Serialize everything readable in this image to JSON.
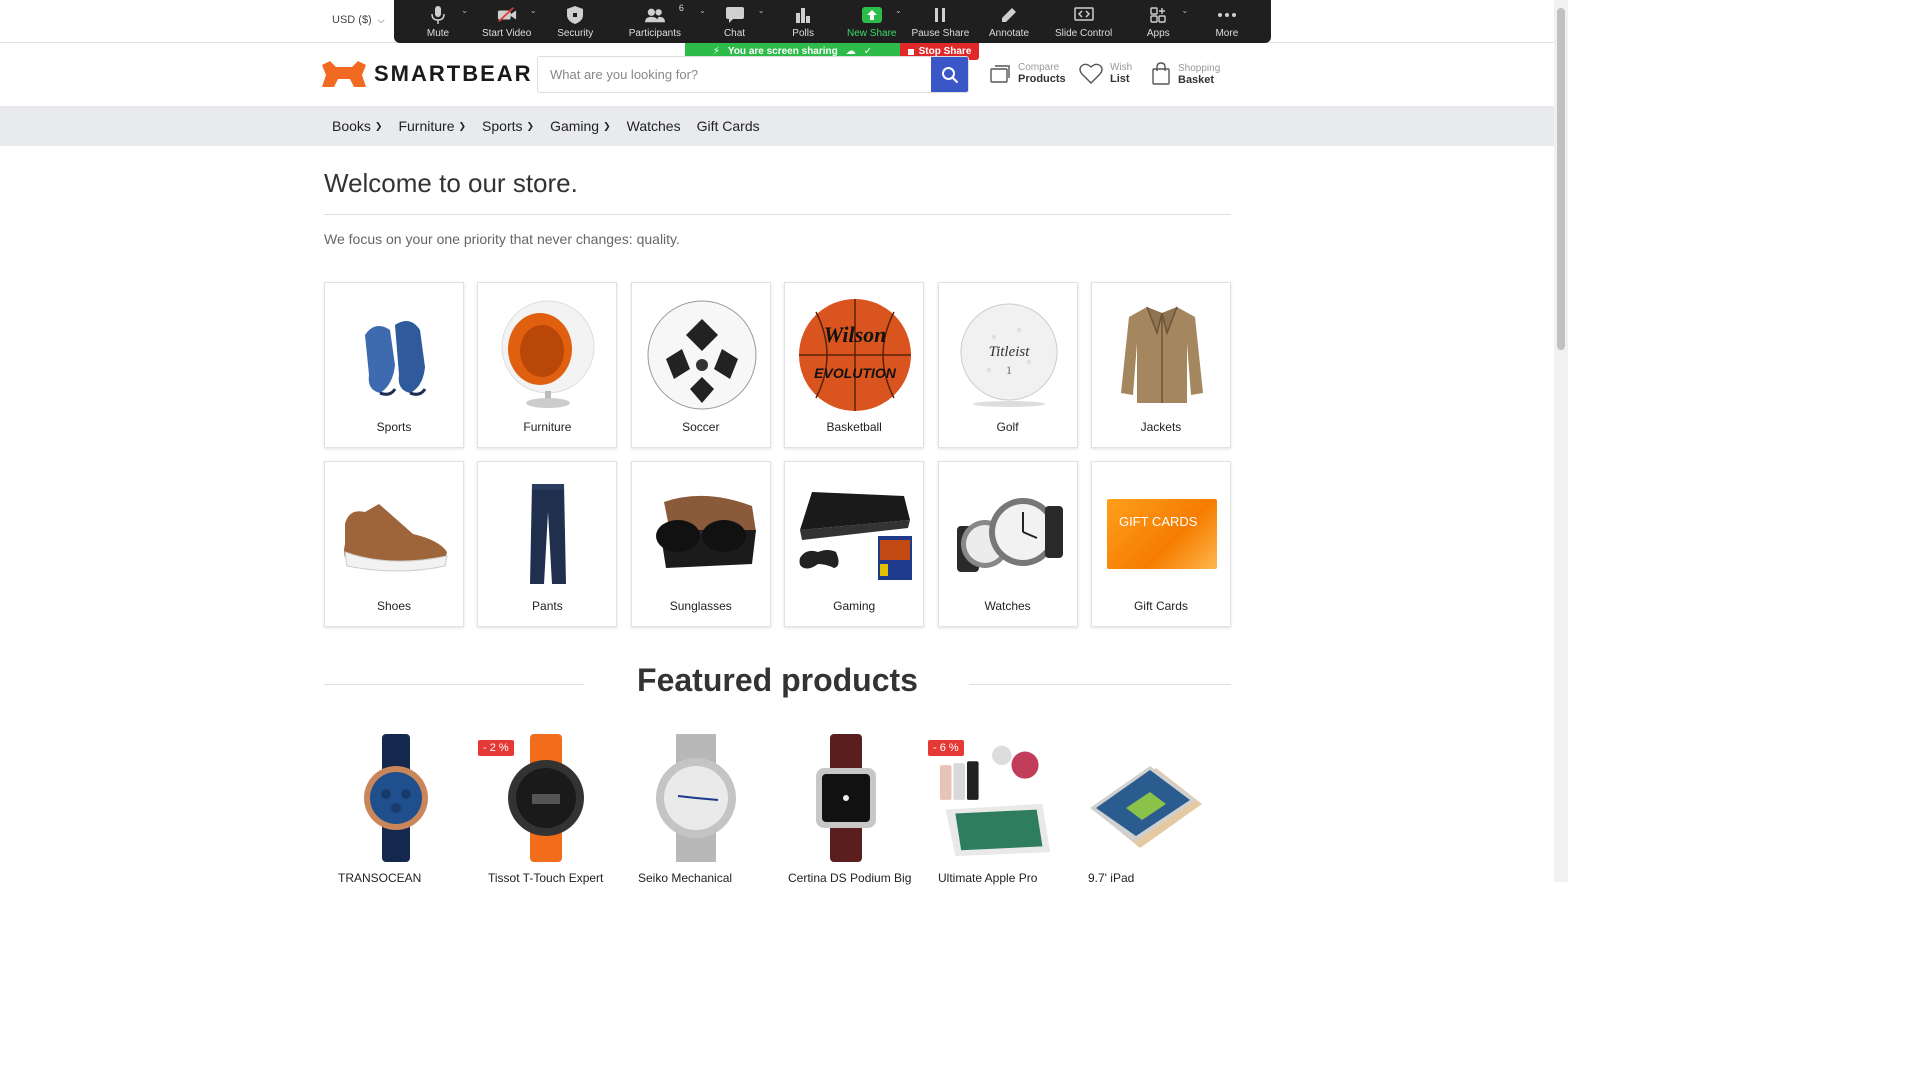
{
  "currency": {
    "label": "USD  ($)"
  },
  "zoom_toolbar": {
    "items": [
      {
        "label": "Mute",
        "icon": "microphone-icon"
      },
      {
        "label": "Start Video",
        "icon": "video-off-icon"
      },
      {
        "label": "Security",
        "icon": "shield-icon"
      },
      {
        "label": "Participants",
        "icon": "participants-icon",
        "count": "6"
      },
      {
        "label": "Chat",
        "icon": "chat-icon"
      },
      {
        "label": "Polls",
        "icon": "polls-icon"
      },
      {
        "label": "New Share",
        "icon": "share-up-icon"
      },
      {
        "label": "Pause Share",
        "icon": "pause-icon"
      },
      {
        "label": "Annotate",
        "icon": "pencil-icon"
      },
      {
        "label": "Slide Control",
        "icon": "slide-control-icon"
      },
      {
        "label": "Apps",
        "icon": "apps-icon"
      },
      {
        "label": "More",
        "icon": "more-dots-icon"
      }
    ],
    "sharing_status": "You are screen sharing",
    "stop_share": "Stop Share",
    "active_color": "#3adb6a"
  },
  "header": {
    "logo_text": "SMARTBEAR",
    "brand_color": "#f26a21",
    "search_placeholder": "What are you looking for?",
    "compare": {
      "small": "Compare",
      "big": "Products"
    },
    "wishlist": {
      "small": "Wish",
      "big": "List"
    },
    "basket": {
      "small": "Shopping",
      "big": "Basket"
    }
  },
  "nav": {
    "items": [
      {
        "label": "Books",
        "dropdown": true
      },
      {
        "label": "Furniture",
        "dropdown": true
      },
      {
        "label": "Sports",
        "dropdown": true
      },
      {
        "label": "Gaming",
        "dropdown": true
      },
      {
        "label": "Watches",
        "dropdown": false
      },
      {
        "label": "Gift Cards",
        "dropdown": false
      }
    ]
  },
  "main": {
    "title": "Welcome to our store.",
    "tagline": "We focus on your one priority that never changes: quality.",
    "categories": [
      {
        "label": "Sports"
      },
      {
        "label": "Furniture"
      },
      {
        "label": "Soccer"
      },
      {
        "label": "Basketball"
      },
      {
        "label": "Golf"
      },
      {
        "label": "Jackets"
      },
      {
        "label": "Shoes"
      },
      {
        "label": "Pants"
      },
      {
        "label": "Sunglasses"
      },
      {
        "label": "Gaming"
      },
      {
        "label": "Watches"
      },
      {
        "label": "Gift Cards"
      }
    ],
    "gift_card_text": "GIFT CARDS",
    "featured_title": "Featured products",
    "products": [
      {
        "name": "TRANSOCEAN",
        "badge": ""
      },
      {
        "name": "Tissot T-Touch Expert",
        "badge": "- 2 %"
      },
      {
        "name": "Seiko Mechanical",
        "badge": ""
      },
      {
        "name": "Certina DS Podium Big",
        "badge": ""
      },
      {
        "name": "Ultimate Apple Pro",
        "badge": "- 6 %"
      },
      {
        "name": "9.7' iPad",
        "badge": ""
      }
    ]
  }
}
